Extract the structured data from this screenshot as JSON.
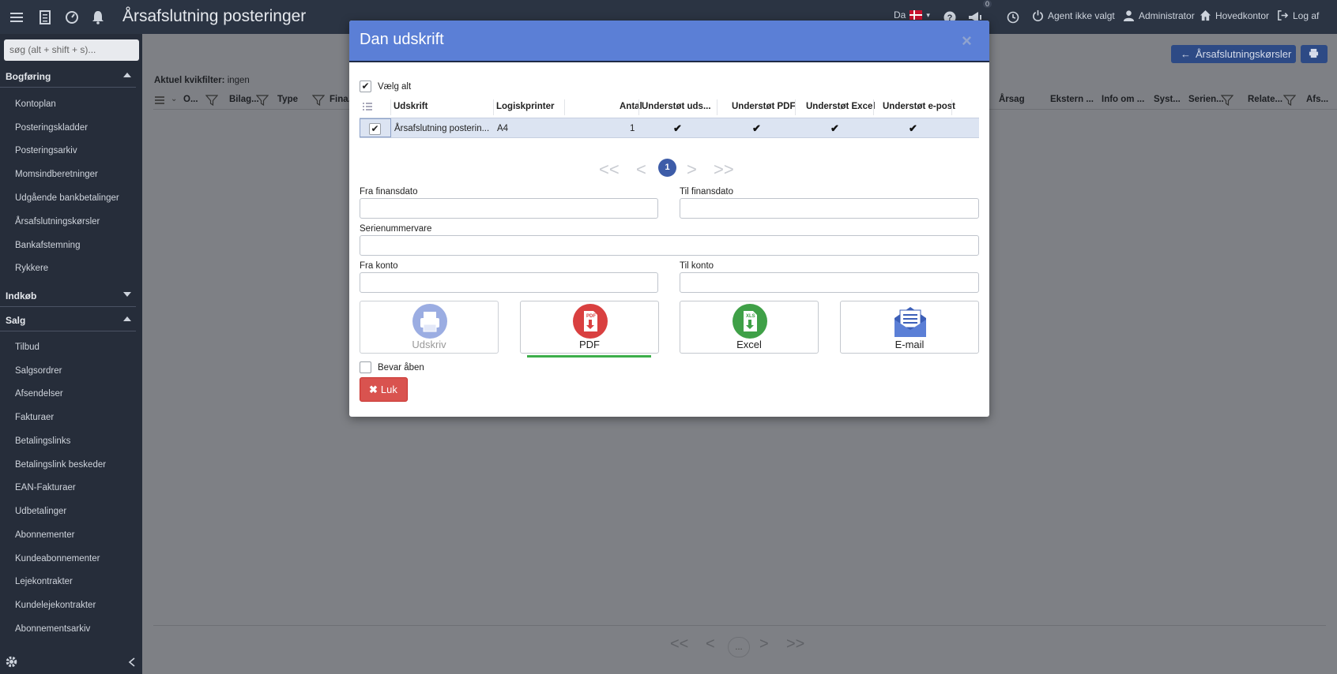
{
  "app": {
    "page_title": "Årsafslutning posteringer",
    "language": "Da",
    "notification_count": "0",
    "agent": "Agent ikke valgt",
    "user": "Administrator",
    "office": "Hovedkontor",
    "logout": "Log af"
  },
  "sidebar": {
    "search_placeholder": "søg (alt + shift + s)...",
    "sections": [
      {
        "label": "Bogføring",
        "items": [
          "Kontoplan",
          "Posteringskladder",
          "Posteringsarkiv",
          "Momsindberetninger",
          "Udgående bankbetalinger",
          "Årsafslutningskørsler",
          "Bankafstemning",
          "Rykkere"
        ]
      },
      {
        "label": "Indkøb",
        "items": []
      },
      {
        "label": "Salg",
        "items": [
          "Tilbud",
          "Salgsordrer",
          "Afsendelser",
          "Fakturaer",
          "Betalingslinks",
          "Betalingslink beskeder",
          "EAN-Fakturaer",
          "Udbetalinger",
          "Abonnementer",
          "Kundeabonnementer",
          "Lejekontrakter",
          "Kundelejekontrakter",
          "Abonnementsarkiv"
        ]
      }
    ]
  },
  "main": {
    "back_button": "Årsafslutningskørsler",
    "quickfilter_label": "Aktuel kvikfilter:",
    "quickfilter_value": "ingen",
    "columns": [
      "O...",
      "Bilag...",
      "Type",
      "Fina...",
      "Årsag",
      "Ekstern ...",
      "Info om ...",
      "Syst...",
      "Serien...",
      "Relate...",
      "Afs..."
    ],
    "pager": {
      "first": "<<",
      "prev": "<",
      "current": "...",
      "next": ">",
      "last": ">>"
    }
  },
  "modal": {
    "title": "Dan udskrift",
    "close": "×",
    "select_all": "Vælg alt",
    "table_headers": [
      "Udskrift",
      "Logiskprinter",
      "Antal",
      "Understøt uds...",
      "Understøt PDF",
      "Understøt Excel",
      "Understøt e-post"
    ],
    "rows": [
      {
        "udskrift": "Årsafslutning posterin...",
        "printer": "A4",
        "antal": "1",
        "checks": [
          "✔",
          "✔",
          "✔",
          "✔"
        ]
      }
    ],
    "pager": {
      "first": "<<",
      "prev": "<",
      "current": "1",
      "next": ">",
      "last": ">>"
    },
    "fields": {
      "fra_finansdato": "Fra finansdato",
      "til_finansdato": "Til finansdato",
      "serienummervare": "Serienummervare",
      "fra_konto": "Fra konto",
      "til_konto": "Til konto"
    },
    "outputs": [
      {
        "label": "Udskriv",
        "color": "#8a9fde"
      },
      {
        "label": "PDF",
        "color": "#d94040"
      },
      {
        "label": "Excel",
        "color": "#3fa047"
      },
      {
        "label": "E-mail",
        "color": "#3c5fb8"
      }
    ],
    "keep_open": "Bevar åben",
    "close_button": "Luk"
  }
}
